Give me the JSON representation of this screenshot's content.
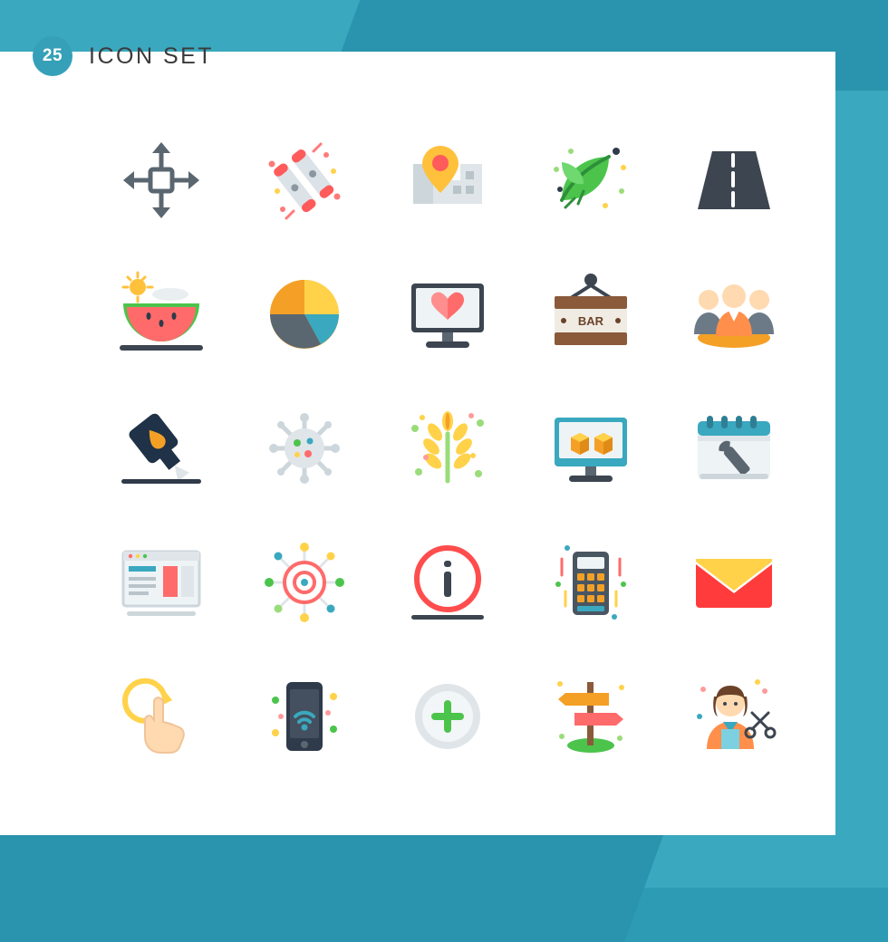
{
  "header": {
    "badge_count": "25",
    "title": "ICON SET"
  },
  "colors": {
    "background_teal": "#3aa8bf",
    "background_teal_dark": "#2a93ad",
    "card_white": "#ffffff",
    "badge_blue": "#35a0b8",
    "title_gray": "#3a3a3a"
  },
  "grid": {
    "rows": 5,
    "columns": 5,
    "total": 25,
    "icons": [
      {
        "name": "move-arrows-icon",
        "label": "Move"
      },
      {
        "name": "firecracker-icon",
        "label": "Firecracker"
      },
      {
        "name": "map-location-pin-icon",
        "label": "Map Location"
      },
      {
        "name": "leaf-eco-icon",
        "label": "Leaf"
      },
      {
        "name": "road-icon",
        "label": "Road"
      },
      {
        "name": "watermelon-icon",
        "label": "Watermelon"
      },
      {
        "name": "pie-chart-icon",
        "label": "Pie Chart"
      },
      {
        "name": "monitor-heart-icon",
        "label": "Monitor Love"
      },
      {
        "name": "bar-sign-icon",
        "label": "Bar Sign"
      },
      {
        "name": "team-group-icon",
        "label": "Team"
      },
      {
        "name": "water-pump-icon",
        "label": "Water Pump"
      },
      {
        "name": "bacteria-germ-icon",
        "label": "Bacteria"
      },
      {
        "name": "wheat-plant-icon",
        "label": "Wheat"
      },
      {
        "name": "monitor-boxes-icon",
        "label": "Monitor Boxes"
      },
      {
        "name": "calendar-wrench-icon",
        "label": "Maintenance Calendar"
      },
      {
        "name": "web-layout-icon",
        "label": "Web Layout"
      },
      {
        "name": "target-network-icon",
        "label": "Target Network"
      },
      {
        "name": "info-circle-icon",
        "label": "Information"
      },
      {
        "name": "calculator-icon",
        "label": "Calculator"
      },
      {
        "name": "envelope-mail-icon",
        "label": "Mail"
      },
      {
        "name": "rotate-gesture-icon",
        "label": "Rotate Gesture"
      },
      {
        "name": "mobile-wifi-icon",
        "label": "Mobile Wifi"
      },
      {
        "name": "add-circle-icon",
        "label": "Add"
      },
      {
        "name": "direction-signpost-icon",
        "label": "Signpost"
      },
      {
        "name": "hairdresser-icon",
        "label": "Hairdresser"
      }
    ]
  }
}
